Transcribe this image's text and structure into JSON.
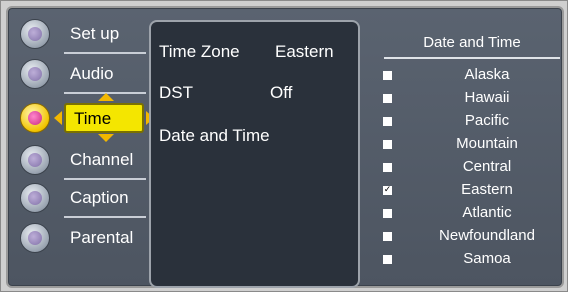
{
  "menu": {
    "items": [
      {
        "label": "Set up",
        "icon": "setup-icon"
      },
      {
        "label": "Audio",
        "icon": "audio-icon"
      },
      {
        "label": "Time",
        "icon": "time-icon",
        "selected": true
      },
      {
        "label": "Channel",
        "icon": "channel-icon"
      },
      {
        "label": "Caption",
        "icon": "caption-icon"
      },
      {
        "label": "Parental",
        "icon": "parental-icon"
      }
    ]
  },
  "settings": {
    "time_zone_label": "Time Zone",
    "time_zone_value": "Eastern",
    "dst_label": "DST",
    "dst_value": "Off",
    "date_time_label": "Date and Time"
  },
  "time_zone_list": {
    "header": "Date and Time",
    "items": [
      {
        "name": "Alaska",
        "checked": false
      },
      {
        "name": "Hawaii",
        "checked": false
      },
      {
        "name": "Pacific",
        "checked": false
      },
      {
        "name": "Mountain",
        "checked": false
      },
      {
        "name": "Central",
        "checked": false
      },
      {
        "name": "Eastern",
        "checked": true
      },
      {
        "name": "Atlantic",
        "checked": false
      },
      {
        "name": "Newfoundland",
        "checked": false
      },
      {
        "name": "Samoa",
        "checked": false
      }
    ],
    "check_mark": "✓"
  },
  "colors": {
    "panel_bg": "#505866",
    "highlight": "#f4e600",
    "arrow": "#f2b700",
    "text": "#ffffff"
  }
}
